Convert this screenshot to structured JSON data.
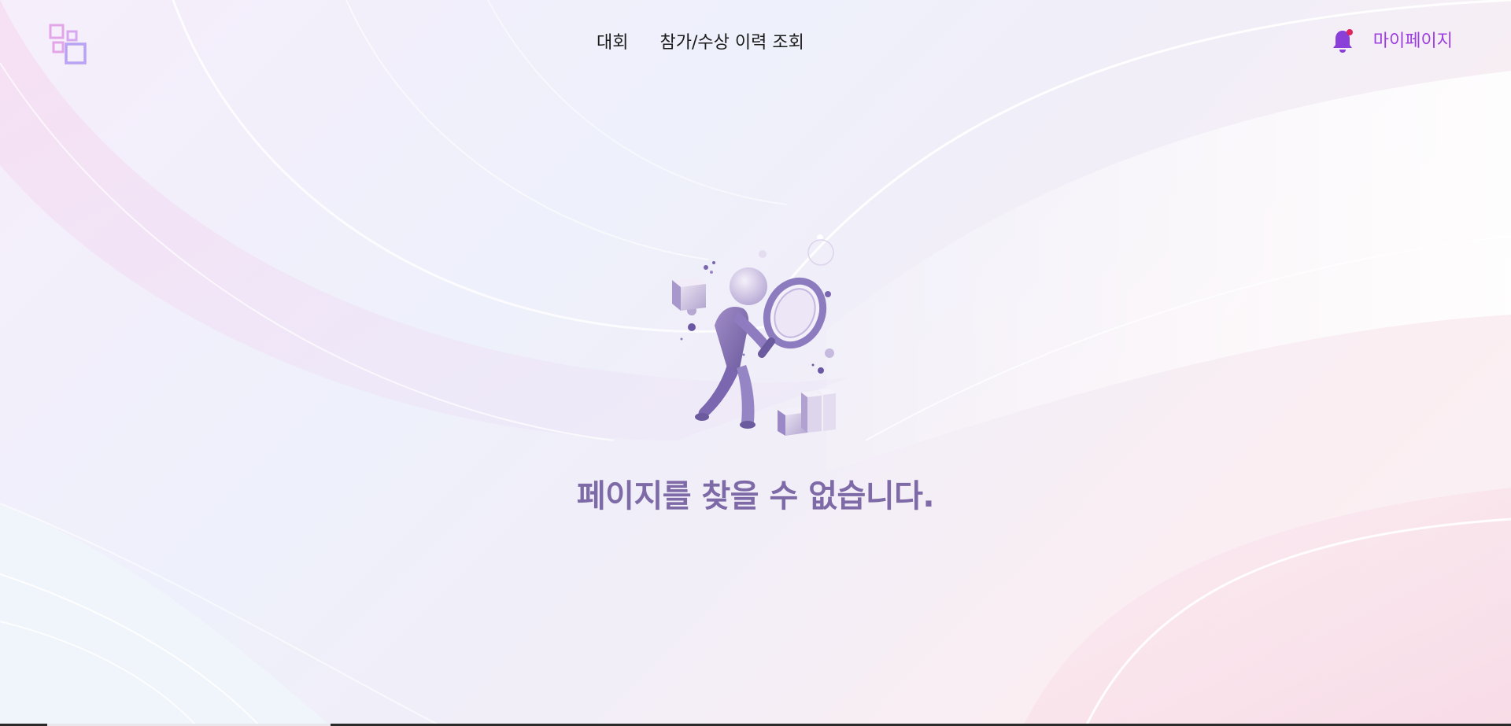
{
  "header": {
    "logo_icon": "squares-logo-icon",
    "nav": [
      {
        "label": "대회"
      },
      {
        "label": "참가/수상 이력 조회"
      }
    ],
    "notification_icon": "bell-icon",
    "notification_dot_color": "#e0245e",
    "mypage_label": "마이페이지"
  },
  "main": {
    "illustration_icon": "person-magnifier-search-illustration",
    "message": "페이지를 찾을 수 없습니다."
  },
  "colors": {
    "accent": "#9b3de0",
    "message": "#7d6aa6",
    "logo": "#c9a3f0"
  }
}
